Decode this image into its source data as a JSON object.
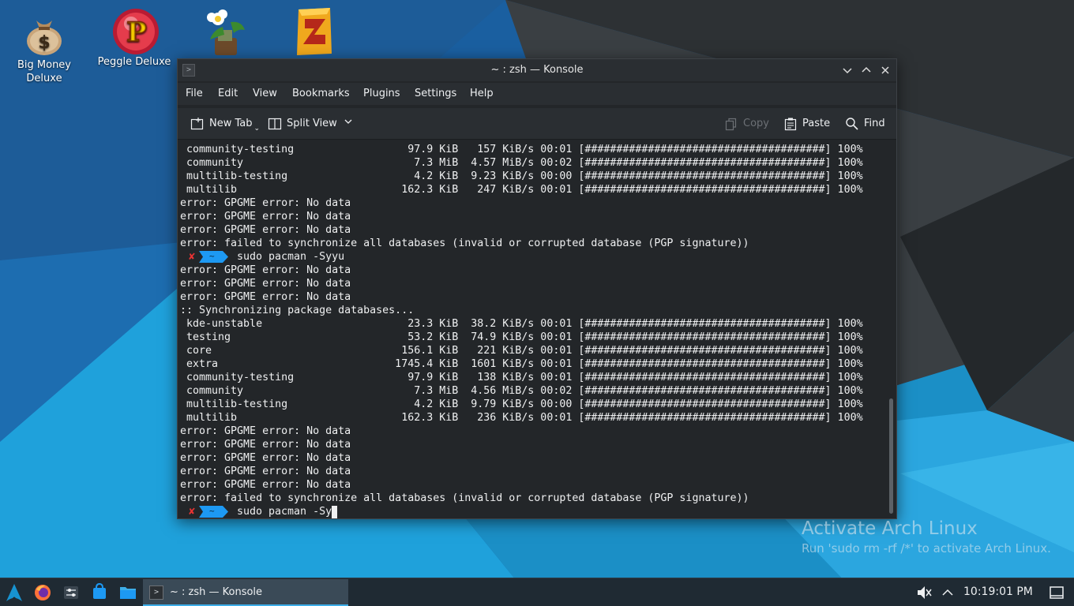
{
  "desktop": {
    "icons": [
      {
        "label_line1": "Big Money",
        "label_line2": "Deluxe",
        "icon": "money-bag-icon"
      },
      {
        "label_line1": "Peggle Deluxe",
        "label_line2": "",
        "icon": "peggle-icon"
      },
      {
        "label_line1": "",
        "label_line2": "",
        "icon": "plants-vs-zombies-icon"
      },
      {
        "label_line1": "",
        "label_line2": "",
        "icon": "zuma-icon"
      }
    ],
    "activation": {
      "title": "Activate Arch Linux",
      "subtitle": "Run 'sudo rm -rf /*' to activate Arch Linux."
    }
  },
  "window": {
    "title": "~ : zsh — Konsole",
    "app_icon_glyph": ">",
    "controls": {
      "minimize": "﹀",
      "maximize": "︿",
      "close": "✕"
    },
    "menu": [
      "File",
      "Edit",
      "View",
      "Bookmarks",
      "Plugins",
      "Settings",
      "Help"
    ],
    "toolbar": {
      "new_tab": "New Tab",
      "split_view": "Split View",
      "copy": "Copy",
      "paste": "Paste",
      "find": "Find"
    }
  },
  "terminal": {
    "lines": [
      " community-testing                  97.9 KiB   157 KiB/s 00:01 [######################################] 100%",
      " community                           7.3 MiB  4.57 MiB/s 00:02 [######################################] 100%",
      " multilib-testing                    4.2 KiB  9.23 KiB/s 00:00 [######################################] 100%",
      " multilib                          162.3 KiB   247 KiB/s 00:01 [######################################] 100%",
      "error: GPGME error: No data",
      "error: GPGME error: No data",
      "error: GPGME error: No data",
      "error: failed to synchronize all databases (invalid or corrupted database (PGP signature))",
      "__PROMPT__0",
      "error: GPGME error: No data",
      "error: GPGME error: No data",
      "error: GPGME error: No data",
      ":: Synchronizing package databases...",
      " kde-unstable                       23.3 KiB  38.2 KiB/s 00:01 [######################################] 100%",
      " testing                            53.2 KiB  74.9 KiB/s 00:01 [######################################] 100%",
      " core                              156.1 KiB   221 KiB/s 00:01 [######################################] 100%",
      " extra                            1745.4 KiB  1601 KiB/s 00:01 [######################################] 100%",
      " community-testing                  97.9 KiB   138 KiB/s 00:01 [######################################] 100%",
      " community                           7.3 MiB  4.56 MiB/s 00:02 [######################################] 100%",
      " multilib-testing                    4.2 KiB  9.79 KiB/s 00:00 [######################################] 100%",
      " multilib                          162.3 KiB   236 KiB/s 00:01 [######################################] 100%",
      "error: GPGME error: No data",
      "error: GPGME error: No data",
      "error: GPGME error: No data",
      "error: GPGME error: No data",
      "error: GPGME error: No data",
      "error: failed to synchronize all databases (invalid or corrupted database (PGP signature))",
      "__PROMPT__1"
    ],
    "prompts": [
      {
        "status": "✘",
        "dir": "~",
        "command": "sudo pacman -Syyu",
        "cursor": false
      },
      {
        "status": "✘",
        "dir": "~",
        "command": "sudo pacman -Sy",
        "cursor": true
      }
    ],
    "colors": {
      "background": "#232629",
      "foreground": "#eff0f1",
      "error_x": "#e93333",
      "prompt_segment": "#1d99f3"
    }
  },
  "taskbar": {
    "launchers": [
      "arch-menu-icon",
      "firefox-icon",
      "system-settings-icon",
      "discover-store-icon",
      "file-manager-icon"
    ],
    "task_label": "~ : zsh — Konsole",
    "clock": "10:19:01 PM",
    "tray": [
      "volume-muted-icon",
      "tray-expand-icon",
      "show-desktop-icon"
    ]
  }
}
